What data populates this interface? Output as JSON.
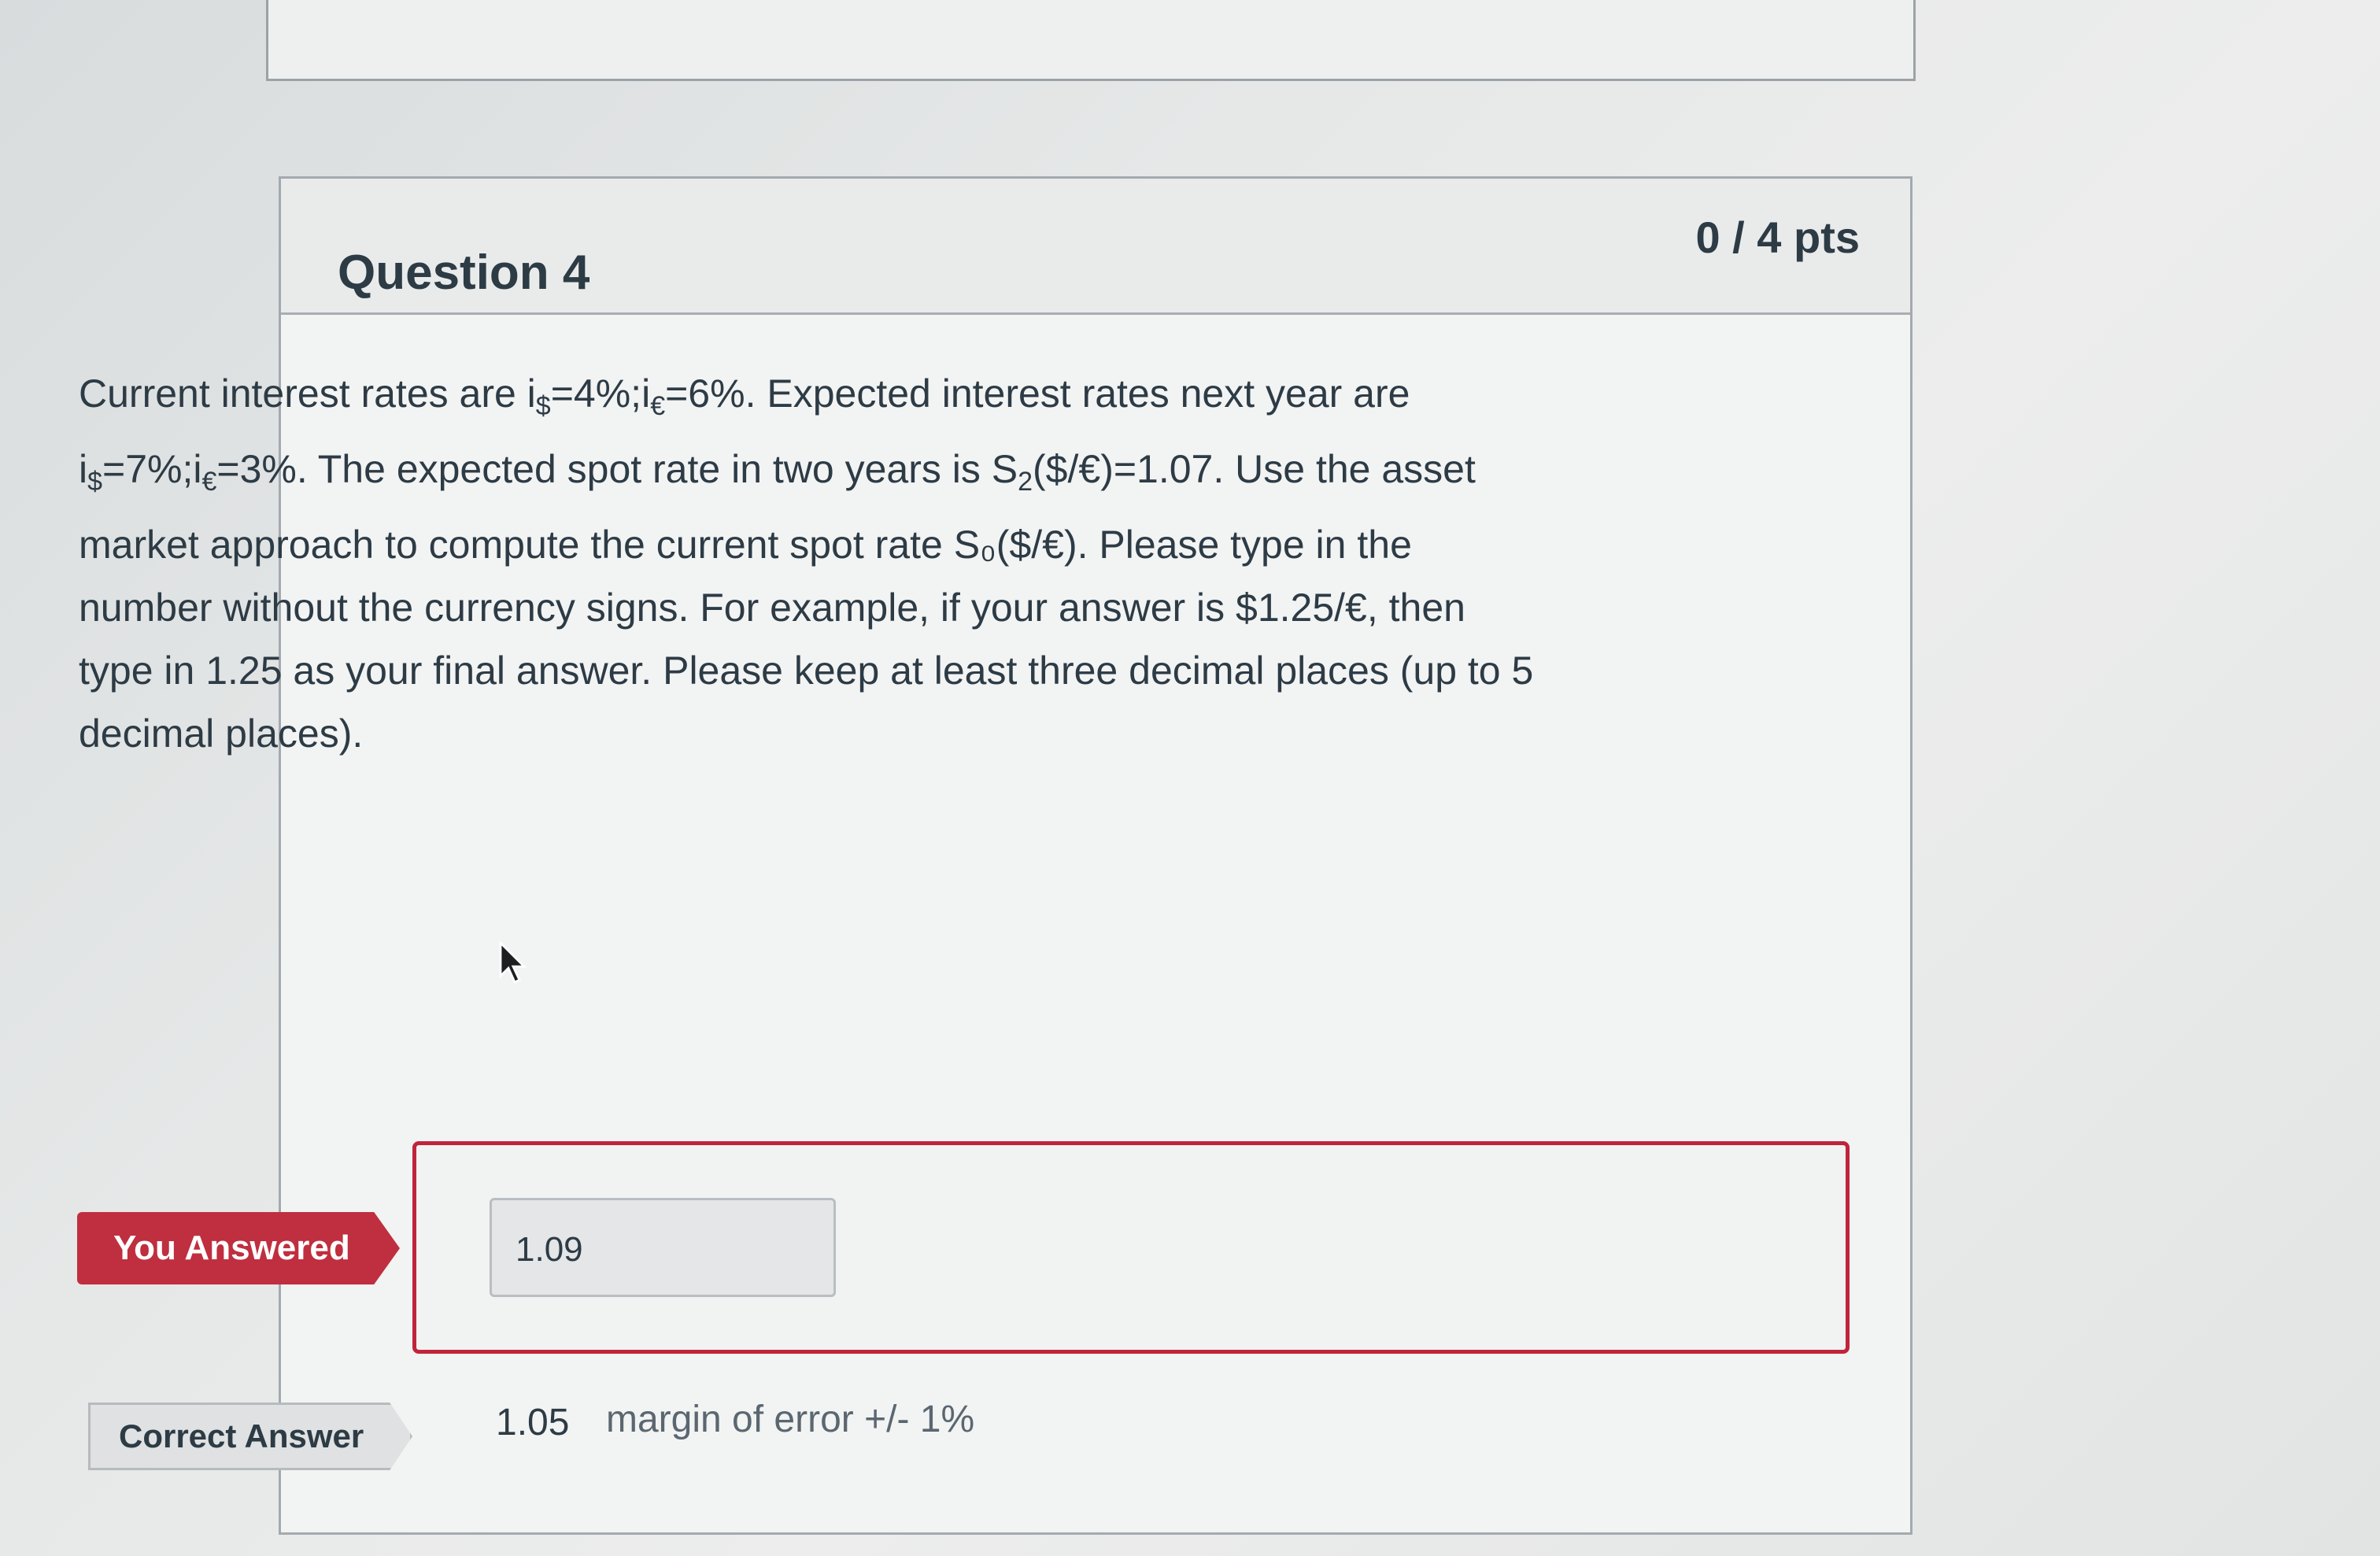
{
  "question": {
    "title": "Question 4",
    "points": "0 / 4 pts",
    "text": {
      "l1a": "Current interest rates are i",
      "l1b": "$",
      "l1c": "=4%;i",
      "l1d": "€",
      "l1e": "=6%. Expected interest rates next year are",
      "l2a": "i",
      "l2b": "$",
      "l2c": "=7%;i",
      "l2d": "€",
      "l2e": "=3%. The expected spot rate in two years is S",
      "l2f": "2",
      "l2g": "($/€)=1.07. Use the asset",
      "l3": "market approach to compute the current spot rate  S₀($/€).  Please type in the",
      "l4": "number without the currency signs. For example, if your answer is $1.25/€, then",
      "l5": "type in 1.25 as your final answer.  Please keep at least three decimal places (up to 5",
      "l6": "decimal places)."
    }
  },
  "answer": {
    "you_answered_label": "You Answered",
    "you_answered_value": "1.09",
    "correct_answer_label": "Correct Answer",
    "correct_answer_value": "1.05",
    "correct_answer_margin": "margin of error +/- 1%"
  },
  "colors": {
    "incorrect": "#bf2f3f",
    "text": "#2d3b45"
  },
  "icons": {
    "cursor": "mouse-pointer-icon"
  }
}
